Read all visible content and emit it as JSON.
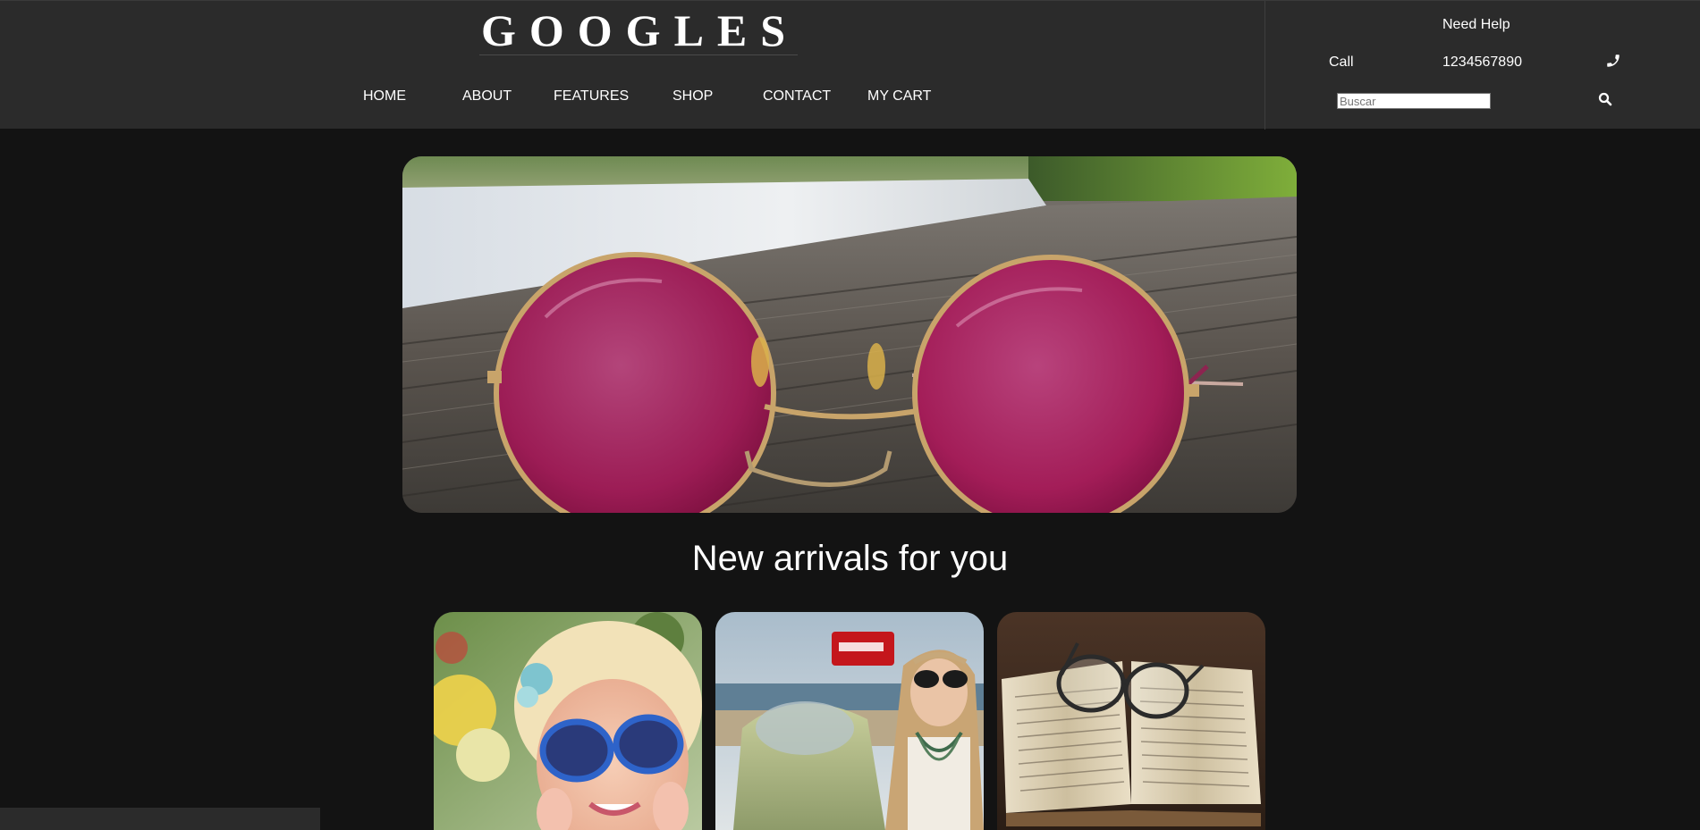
{
  "brand": {
    "logo_text": "GOOGLES"
  },
  "nav": {
    "items": [
      {
        "label": "HOME"
      },
      {
        "label": "ABOUT"
      },
      {
        "label": "FEATURES"
      },
      {
        "label": "SHOP"
      },
      {
        "label": "CONTACT"
      },
      {
        "label": "MY CART"
      }
    ]
  },
  "help": {
    "title": "Need Help",
    "call_label": "Call",
    "phone_number": "1234567890",
    "phone_icon": "phone-icon",
    "search_placeholder": "Buscar",
    "search_value": "",
    "search_icon": "search-icon"
  },
  "hero": {
    "image": "pink-round-sunglasses-on-wooden-dock",
    "lens_color": "#c2185b"
  },
  "arrivals": {
    "title": "New arrivals for you",
    "cards": [
      {
        "image": "woman-with-blue-sunglasses"
      },
      {
        "image": "woman-with-sunglasses-by-vintage-car"
      },
      {
        "image": "reading-glasses-on-open-book"
      }
    ]
  },
  "colors": {
    "background": "#131313",
    "header": "#2b2b2b",
    "text": "#ffffff"
  }
}
